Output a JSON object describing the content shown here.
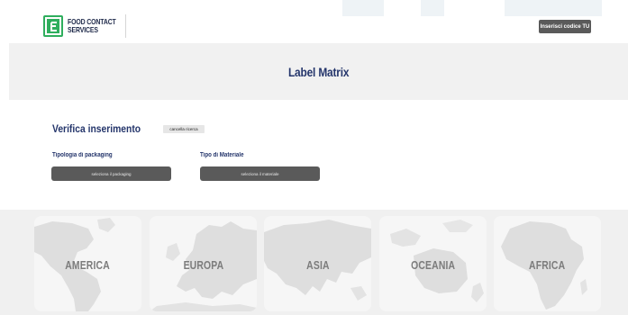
{
  "header": {
    "logo_line1": "FOOD CONTACT",
    "logo_line2": "SERVICES",
    "tu_button": "Inserisci codice TU"
  },
  "banner": {
    "title": "Label Matrix"
  },
  "verify": {
    "title": "Verifica inserimento",
    "clear_button": "cancella ricerca",
    "packaging": {
      "label": "Tipologia di packaging",
      "select": "seleziona il packaging"
    },
    "material": {
      "label": "Tipo di Materiale",
      "select": "seleziona il materiale"
    }
  },
  "continents": [
    {
      "label": "AMERICA",
      "icon": "americas-map-icon"
    },
    {
      "label": "EUROPA",
      "icon": "europe-map-icon"
    },
    {
      "label": "ASIA",
      "icon": "asia-map-icon"
    },
    {
      "label": "OCEANIA",
      "icon": "oceania-map-icon"
    },
    {
      "label": "AFRICA",
      "icon": "africa-map-icon"
    }
  ],
  "colors": {
    "brand_green": "#2fae5d",
    "navy": "#24356b",
    "button_gray": "#5a5a5a",
    "banner_bg": "#f1f1f1"
  }
}
